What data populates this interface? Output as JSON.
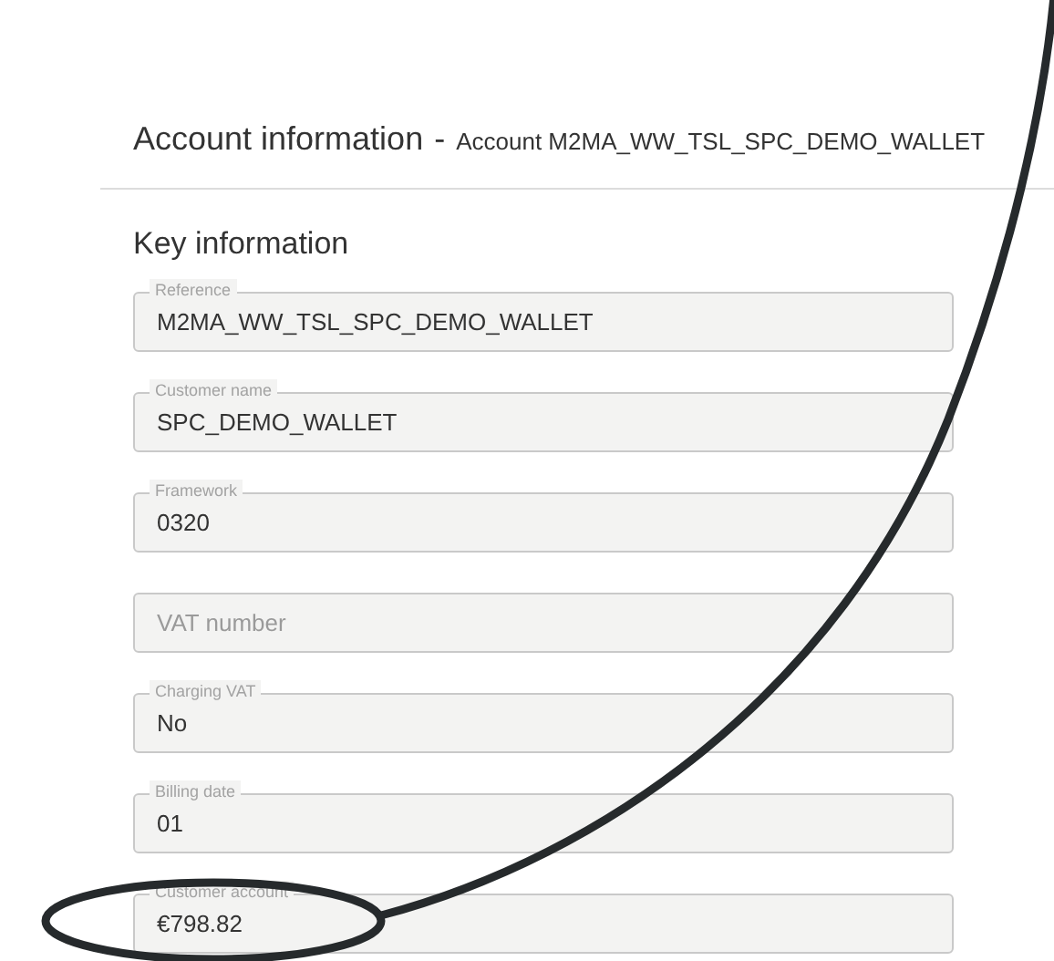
{
  "header": {
    "title": "Account information",
    "separator": "-",
    "subtitle": "Account M2MA_WW_TSL_SPC_DEMO_WALLET"
  },
  "section": {
    "title": "Key information"
  },
  "fields": [
    {
      "label": "Reference",
      "value": "M2MA_WW_TSL_SPC_DEMO_WALLET"
    },
    {
      "label": "Customer name",
      "value": "SPC_DEMO_WALLET"
    },
    {
      "label": "Framework",
      "value": "0320"
    },
    {
      "placeholder": "VAT number"
    },
    {
      "label": "Charging VAT",
      "value": "No"
    },
    {
      "label": "Billing date",
      "value": "01"
    },
    {
      "label": "Customer account",
      "value": "€798.82"
    }
  ]
}
